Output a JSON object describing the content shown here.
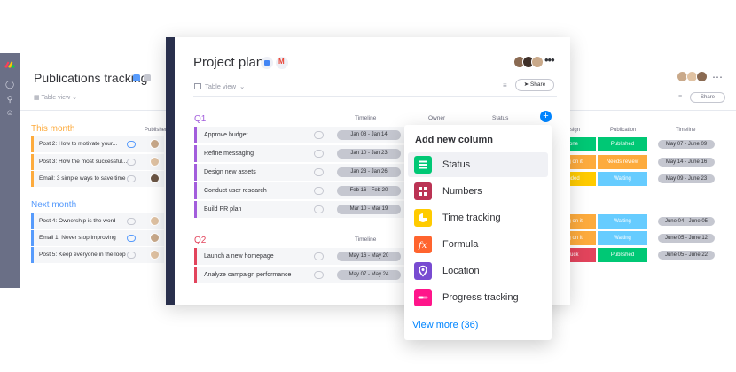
{
  "background_board": {
    "title": "Publications tracking",
    "table_view": "Table view",
    "groups": [
      {
        "title": "This month",
        "color": "#fdab3d",
        "rows": [
          "Post 2: How to motivate your...",
          "Post 3: How the most successful...",
          "Email: 3 simple ways to save time"
        ]
      },
      {
        "title": "Next month",
        "color": "#579bfc",
        "rows": [
          "Post 4: Ownership is the word",
          "Email 1: Never stop improving",
          "Post 5: Keep everyone in the loop"
        ]
      }
    ],
    "column_publisher": "Publisher",
    "right": {
      "col_design": "sign",
      "col_publication": "Publication",
      "col_timeline": "Timeline",
      "share": "Share",
      "rows_this_month": [
        {
          "design": "one",
          "publication": "Published",
          "date": "May 07 - June 09"
        },
        {
          "design": "ng on it",
          "publication": "Needs review",
          "date": "May 14 - June 16"
        },
        {
          "design": "nded",
          "publication": "Waiting",
          "date": "May 09 - June 23"
        }
      ],
      "rows_next_month": [
        {
          "design": "ng on it",
          "publication": "Waiting",
          "date": "June 04 - June 05"
        },
        {
          "design": "ng on it",
          "publication": "Waiting",
          "date": "June 05 - June 12"
        },
        {
          "design": "tuck",
          "publication": "Published",
          "date": "June 05 - June 22"
        }
      ]
    }
  },
  "card": {
    "title": "Project plan",
    "table_view": "Table view",
    "share": "Share",
    "dots": "•••",
    "columns": {
      "timeline": "Timeline",
      "owner": "Owner",
      "status": "Status"
    },
    "groups": [
      {
        "title": "Q1",
        "color": "#a25ddc",
        "tasks": [
          {
            "name": "Approve budget",
            "date": "Jan 08 - Jan 14"
          },
          {
            "name": "Refine messaging",
            "date": "Jan 10 - Jan 23"
          },
          {
            "name": "Design new assets",
            "date": "Jan 23 - Jan 26"
          },
          {
            "name": "Conduct user research",
            "date": "Feb 16 - Feb 20"
          },
          {
            "name": "Build PR plan",
            "date": "Mar 10 - Mar 19"
          }
        ]
      },
      {
        "title": "Q2",
        "color": "#e2445c",
        "tasks": [
          {
            "name": "Launch a new homepage",
            "date": "May 16 - May 20"
          },
          {
            "name": "Analyze campaign performance",
            "date": "May 07 - May 24"
          }
        ]
      }
    ],
    "add_button": "+"
  },
  "dropdown": {
    "title": "Add new column",
    "items": [
      {
        "label": "Status",
        "icon": "status-icon",
        "color": "#00c875"
      },
      {
        "label": "Numbers",
        "icon": "numbers-icon",
        "color": "#bb3354"
      },
      {
        "label": "Time tracking",
        "icon": "time-tracking-icon",
        "color": "#ffcb00"
      },
      {
        "label": "Formula",
        "icon": "formula-icon",
        "color": "#ff642e"
      },
      {
        "label": "Location",
        "icon": "location-icon",
        "color": "#784bd1"
      },
      {
        "label": "Progress tracking",
        "icon": "progress-tracking-icon",
        "color": "#ff158a"
      }
    ],
    "view_more": "View more (36)"
  }
}
